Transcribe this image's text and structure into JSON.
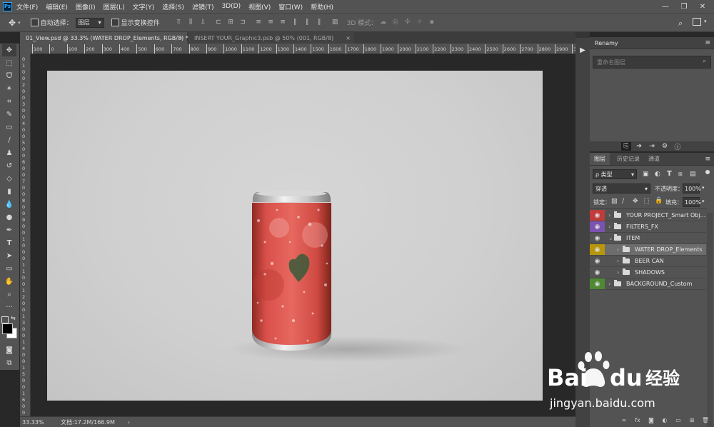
{
  "app": {
    "logo": "Ps"
  },
  "menu": [
    "文件(F)",
    "编辑(E)",
    "图像(I)",
    "图层(L)",
    "文字(Y)",
    "选择(S)",
    "滤镜(T)",
    "3D(D)",
    "视图(V)",
    "窗口(W)",
    "帮助(H)"
  ],
  "window_controls": [
    "—",
    "❐",
    "✕"
  ],
  "options_bar": {
    "auto_select_label": "自动选择：",
    "auto_select_value": "图层",
    "show_transform_label": "显示变换控件",
    "mode_3d_label": "3D 模式："
  },
  "tabs": [
    {
      "label": "01_View.psd @ 33.3% (WATER DROP_Elements, RGB/8) *",
      "active": true,
      "close": "×"
    },
    {
      "label": "INSERT YOUR_Graphic3.psb @ 50% (001, RGB/8)",
      "active": false,
      "close": "×"
    }
  ],
  "ruler": {
    "h_labels": [
      "100",
      "0",
      "100",
      "200",
      "300",
      "400",
      "500",
      "600",
      "700",
      "800",
      "900",
      "1000",
      "1100",
      "1200",
      "1300",
      "1400",
      "1500",
      "1600",
      "1700",
      "1800",
      "1900",
      "2000",
      "2100",
      "2200",
      "2300",
      "2400",
      "2500",
      "2600",
      "2700",
      "2800",
      "2900",
      "3000"
    ],
    "v_labels": [
      "0",
      "1",
      "0",
      "0",
      "2",
      "0",
      "0",
      "3",
      "0",
      "0",
      "4",
      "0",
      "0",
      "5",
      "0",
      "0",
      "6",
      "0",
      "0",
      "7",
      "0",
      "0",
      "8",
      "0",
      "0",
      "9",
      "0",
      "0",
      "1",
      "0",
      "0",
      "0",
      "1",
      "1",
      "0",
      "0",
      "1",
      "2",
      "0",
      "0",
      "1",
      "3",
      "0",
      "0",
      "1",
      "4",
      "0",
      "0",
      "1",
      "5",
      "0",
      "0",
      "1",
      "6",
      "0",
      "0"
    ]
  },
  "status": {
    "zoom": "33.33%",
    "doc": "文档:17.2M/166.9M",
    "arrow": "›"
  },
  "renamy_panel": {
    "title": "Renamy",
    "search_placeholder": "重命名图层"
  },
  "layers_panel": {
    "tabs": [
      "图层",
      "历史记录",
      "通道"
    ],
    "filter_label": "ρ 类型",
    "blend_mode": "穿透",
    "opacity_label": "不透明度：",
    "opacity_value": "100%",
    "lock_label": "锁定：",
    "fill_label": "填充：",
    "fill_value": "100%",
    "layers": [
      {
        "name": "YOUR PROJECT_Smart Obj...",
        "color": "#c23b3b",
        "indent": 0,
        "selected": false
      },
      {
        "name": "FILTERS_FX",
        "color": "#7b52b0",
        "indent": 0,
        "selected": false
      },
      {
        "name": "ITEM",
        "color": "",
        "indent": 0,
        "selected": false,
        "expanded": true
      },
      {
        "name": "WATER DROP_Elements",
        "color": "#b8960c",
        "indent": 1,
        "selected": true
      },
      {
        "name": "BEER CAN",
        "color": "",
        "indent": 1,
        "selected": false
      },
      {
        "name": "SHADOWS",
        "color": "",
        "indent": 1,
        "selected": false
      },
      {
        "name": "BACKGROUND_Custom",
        "color": "#4e8a31",
        "indent": 0,
        "selected": false
      }
    ],
    "bottom_icons": [
      "link-icon",
      "fx-icon",
      "mask-icon",
      "adjustment-icon",
      "group-icon",
      "new-layer-icon",
      "trash-icon"
    ],
    "bottom_labels": [
      "∞",
      "fx",
      "◙",
      "◐",
      "▭",
      "⊞",
      "🗑"
    ]
  },
  "watermark": {
    "brand": "Bai",
    "brand2": "du",
    "suffix": "经验",
    "url": "jingyan.baidu.com"
  }
}
